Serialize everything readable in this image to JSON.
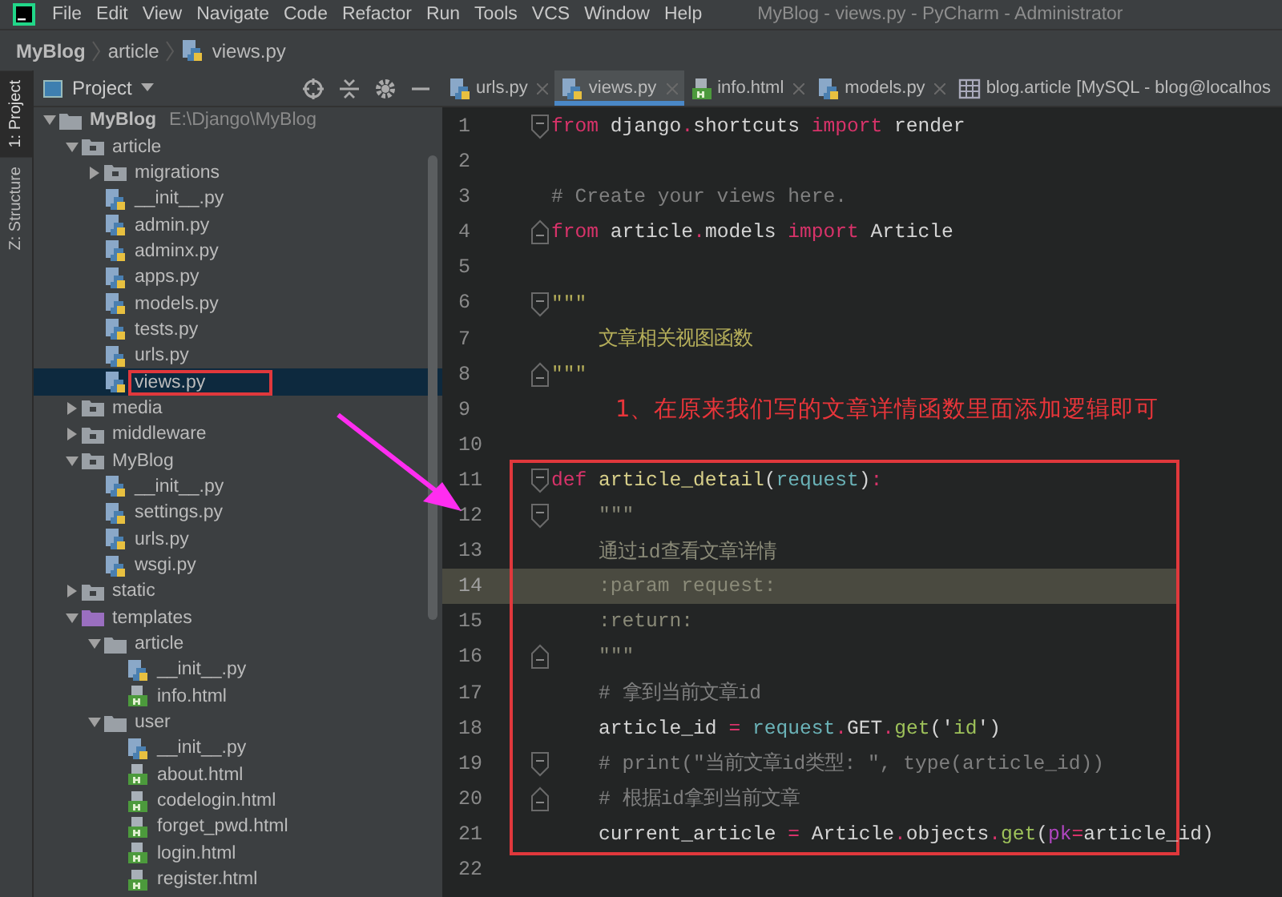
{
  "window": {
    "title": "MyBlog - views.py - PyCharm - Administrator"
  },
  "menu": [
    "File",
    "Edit",
    "View",
    "Navigate",
    "Code",
    "Refactor",
    "Run",
    "Tools",
    "VCS",
    "Window",
    "Help"
  ],
  "breadcrumb": [
    "MyBlog",
    "article",
    "views.py"
  ],
  "tool_strip": [
    {
      "label": "1: Project",
      "selected": true
    },
    {
      "label": "Z: Structure",
      "selected": false
    }
  ],
  "project_panel": {
    "title": "Project",
    "tree": [
      {
        "name": "MyBlog",
        "path": "E:\\Django\\MyBlog",
        "kind": "folder",
        "expanded": true,
        "selected": false,
        "highlighted": false,
        "children": [
          {
            "name": "article",
            "kind": "module",
            "expanded": true,
            "selected": false,
            "highlighted": false,
            "children": [
              {
                "name": "migrations",
                "kind": "module",
                "expanded": false,
                "selected": false,
                "highlighted": false
              },
              {
                "name": "__init__.py",
                "kind": "py",
                "selected": false,
                "highlighted": false
              },
              {
                "name": "admin.py",
                "kind": "py",
                "selected": false,
                "highlighted": false
              },
              {
                "name": "adminx.py",
                "kind": "py",
                "selected": false,
                "highlighted": false
              },
              {
                "name": "apps.py",
                "kind": "py",
                "selected": false,
                "highlighted": false
              },
              {
                "name": "models.py",
                "kind": "py",
                "selected": false,
                "highlighted": false
              },
              {
                "name": "tests.py",
                "kind": "py",
                "selected": false,
                "highlighted": false
              },
              {
                "name": "urls.py",
                "kind": "py",
                "selected": false,
                "highlighted": false
              },
              {
                "name": "views.py",
                "kind": "py",
                "selected": true,
                "highlighted": true
              }
            ]
          },
          {
            "name": "media",
            "kind": "module",
            "expanded": false,
            "selected": false,
            "highlighted": false
          },
          {
            "name": "middleware",
            "kind": "module",
            "expanded": false,
            "selected": false,
            "highlighted": false
          },
          {
            "name": "MyBlog",
            "kind": "module",
            "expanded": true,
            "selected": false,
            "highlighted": false,
            "children": [
              {
                "name": "__init__.py",
                "kind": "py",
                "selected": false,
                "highlighted": false
              },
              {
                "name": "settings.py",
                "kind": "py",
                "selected": false,
                "highlighted": false
              },
              {
                "name": "urls.py",
                "kind": "py",
                "selected": false,
                "highlighted": false
              },
              {
                "name": "wsgi.py",
                "kind": "py",
                "selected": false,
                "highlighted": false
              }
            ]
          },
          {
            "name": "static",
            "kind": "module",
            "expanded": false,
            "selected": false,
            "highlighted": false
          },
          {
            "name": "templates",
            "kind": "template-folder",
            "expanded": true,
            "selected": false,
            "highlighted": false,
            "children": [
              {
                "name": "article",
                "kind": "folder",
                "expanded": true,
                "selected": false,
                "highlighted": false,
                "children": [
                  {
                    "name": "__init__.py",
                    "kind": "py",
                    "selected": false,
                    "highlighted": false
                  },
                  {
                    "name": "info.html",
                    "kind": "html",
                    "selected": false,
                    "highlighted": false
                  }
                ]
              },
              {
                "name": "user",
                "kind": "folder",
                "expanded": true,
                "selected": false,
                "highlighted": false,
                "children": [
                  {
                    "name": "__init__.py",
                    "kind": "py",
                    "selected": false,
                    "highlighted": false
                  },
                  {
                    "name": "about.html",
                    "kind": "html",
                    "selected": false,
                    "highlighted": false
                  },
                  {
                    "name": "codelogin.html",
                    "kind": "html",
                    "selected": false,
                    "highlighted": false
                  },
                  {
                    "name": "forget_pwd.html",
                    "kind": "html",
                    "selected": false,
                    "highlighted": false
                  },
                  {
                    "name": "login.html",
                    "kind": "html",
                    "selected": false,
                    "highlighted": false
                  },
                  {
                    "name": "register.html",
                    "kind": "html",
                    "selected": false,
                    "highlighted": false
                  }
                ]
              }
            ]
          }
        ]
      }
    ]
  },
  "tabs": [
    {
      "label": "urls.py",
      "kind": "py",
      "selected": false
    },
    {
      "label": "views.py",
      "kind": "py",
      "selected": true
    },
    {
      "label": "info.html",
      "kind": "html",
      "selected": false
    },
    {
      "label": "models.py",
      "kind": "py",
      "selected": false
    },
    {
      "label": "blog.article [MySQL - blog@localhos",
      "kind": "table",
      "selected": false
    }
  ],
  "code_lines": [
    {
      "number": "1",
      "fold_start": true,
      "fold_end": false,
      "current": false,
      "tokens": [
        {
          "text": "from",
          "kind": "kw"
        },
        {
          "text": " django",
          "kind": "plain"
        },
        {
          "text": ".",
          "kind": "op"
        },
        {
          "text": "shortcuts ",
          "kind": "plain"
        },
        {
          "text": "import",
          "kind": "kw"
        },
        {
          "text": " render",
          "kind": "plain"
        }
      ]
    },
    {
      "number": "2",
      "fold_start": false,
      "fold_end": false,
      "current": false
    },
    {
      "number": "3",
      "fold_start": false,
      "fold_end": false,
      "current": false,
      "tokens": [
        {
          "text": "# Create your views here.",
          "kind": "comment"
        }
      ]
    },
    {
      "number": "4",
      "fold_start": false,
      "fold_end": true,
      "current": false,
      "tokens": [
        {
          "text": "from",
          "kind": "kw"
        },
        {
          "text": " article",
          "kind": "plain"
        },
        {
          "text": ".",
          "kind": "op"
        },
        {
          "text": "models ",
          "kind": "plain"
        },
        {
          "text": "import",
          "kind": "kw"
        },
        {
          "text": " Article",
          "kind": "plain"
        }
      ]
    },
    {
      "number": "5",
      "fold_start": false,
      "fold_end": false,
      "current": false
    },
    {
      "number": "6",
      "fold_start": true,
      "fold_end": false,
      "current": false,
      "tokens": [
        {
          "text": "\"\"\"",
          "kind": "doc"
        }
      ]
    },
    {
      "number": "7",
      "fold_start": false,
      "fold_end": false,
      "current": false,
      "tokens": [
        {
          "text": "    文章相关视图函数",
          "kind": "doc"
        }
      ]
    },
    {
      "number": "8",
      "fold_start": false,
      "fold_end": true,
      "current": false,
      "tokens": [
        {
          "text": "\"\"\"",
          "kind": "doc"
        }
      ]
    },
    {
      "number": "9",
      "fold_start": false,
      "fold_end": false,
      "current": false,
      "note": "1、在原来我们写的文章详情函数里面添加逻辑即可"
    },
    {
      "number": "10",
      "fold_start": false,
      "fold_end": false,
      "current": false
    }
  ],
  "boxed_lines": [
    {
      "number": "11",
      "fold_start": true,
      "fold_end": false,
      "current": false,
      "tokens": [
        {
          "text": "def",
          "kind": "kw"
        },
        {
          "text": " article_detail",
          "kind": "fn"
        },
        {
          "text": "(",
          "kind": "plain"
        },
        {
          "text": "request",
          "kind": "param"
        },
        {
          "text": ")",
          "kind": "plain"
        },
        {
          "text": ":",
          "kind": "op"
        }
      ]
    },
    {
      "number": "12",
      "fold_start": true,
      "fold_end": false,
      "current": false,
      "tokens": [
        {
          "text": "    \"\"\"",
          "kind": "doc2"
        }
      ]
    },
    {
      "number": "13",
      "fold_start": false,
      "fold_end": false,
      "current": false,
      "tokens": [
        {
          "text": "    通过id查看文章详情",
          "kind": "doc2"
        }
      ]
    },
    {
      "number": "14",
      "fold_start": false,
      "fold_end": false,
      "current": true,
      "tokens": [
        {
          "text": "    :param request:",
          "kind": "doc2"
        }
      ]
    },
    {
      "number": "15",
      "fold_start": false,
      "fold_end": false,
      "current": false,
      "tokens": [
        {
          "text": "    :return:",
          "kind": "doc2"
        }
      ]
    },
    {
      "number": "16",
      "fold_start": false,
      "fold_end": true,
      "current": false,
      "tokens": [
        {
          "text": "    \"\"\"",
          "kind": "doc2"
        }
      ]
    },
    {
      "number": "17",
      "fold_start": false,
      "fold_end": false,
      "current": false,
      "tokens": [
        {
          "text": "    # 拿到当前文章id",
          "kind": "comment"
        }
      ]
    },
    {
      "number": "18",
      "fold_start": false,
      "fold_end": false,
      "current": false,
      "tokens": [
        {
          "text": "    article_id ",
          "kind": "plain"
        },
        {
          "text": "=",
          "kind": "op"
        },
        {
          "text": " request",
          "kind": "param"
        },
        {
          "text": ".",
          "kind": "op"
        },
        {
          "text": "GET",
          "kind": "plain"
        },
        {
          "text": ".",
          "kind": "op"
        },
        {
          "text": "get",
          "kind": "str"
        },
        {
          "text": "('",
          "kind": "plain"
        },
        {
          "text": "id",
          "kind": "str"
        },
        {
          "text": "')",
          "kind": "plain"
        }
      ]
    },
    {
      "number": "19",
      "fold_start": true,
      "fold_end": false,
      "current": false,
      "tokens": [
        {
          "text": "    # print(\"当前文章id类型: \", type(article_id))",
          "kind": "comment"
        }
      ]
    },
    {
      "number": "20",
      "fold_start": false,
      "fold_end": true,
      "current": false,
      "tokens": [
        {
          "text": "    # 根据id拿到当前文章",
          "kind": "comment"
        }
      ]
    },
    {
      "number": "21",
      "fold_start": false,
      "fold_end": false,
      "current": false,
      "tokens": [
        {
          "text": "    current_article ",
          "kind": "plain"
        },
        {
          "text": "=",
          "kind": "op"
        },
        {
          "text": " Article",
          "kind": "plain"
        },
        {
          "text": ".",
          "kind": "op"
        },
        {
          "text": "objects",
          "kind": "plain"
        },
        {
          "text": ".",
          "kind": "op"
        },
        {
          "text": "get",
          "kind": "str"
        },
        {
          "text": "(",
          "kind": "plain"
        },
        {
          "text": "pk",
          "kind": "named"
        },
        {
          "text": "=",
          "kind": "op"
        },
        {
          "text": "article_id)",
          "kind": "plain"
        }
      ]
    }
  ],
  "more_lines": [
    {
      "number": "22",
      "fold_start": false,
      "fold_end": false,
      "current": false
    }
  ]
}
